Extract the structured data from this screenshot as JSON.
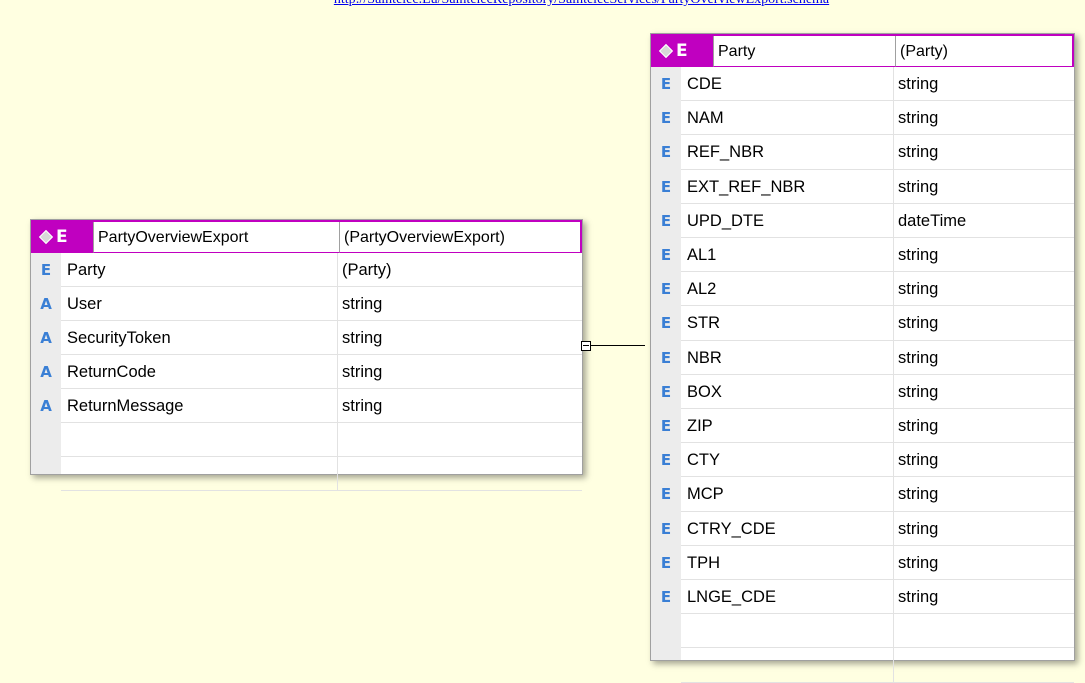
{
  "header_link": {
    "text": "http://Saintelec.Lu/SaintelecRepository/SaintelecServices/PartyOverviewExport.schema"
  },
  "colors": {
    "background": "#ffffe1",
    "header_accent": "#c000c0",
    "element_icon": "#3a7fd5",
    "gutter": "#ececec"
  },
  "icons": {
    "element": "E",
    "attribute": "A",
    "header": "diamond-icon"
  },
  "left_table": {
    "header": {
      "name": "PartyOverviewExport",
      "type": "(PartyOverviewExport)"
    },
    "rows": [
      {
        "kind": "E",
        "name": "Party",
        "type": "(Party)"
      },
      {
        "kind": "A",
        "name": "User",
        "type": "string"
      },
      {
        "kind": "A",
        "name": "SecurityToken",
        "type": "string"
      },
      {
        "kind": "A",
        "name": "ReturnCode",
        "type": "string"
      },
      {
        "kind": "A",
        "name": "ReturnMessage",
        "type": "string"
      }
    ]
  },
  "right_table": {
    "header": {
      "name": "Party",
      "type": "(Party)"
    },
    "rows": [
      {
        "kind": "E",
        "name": "CDE",
        "type": "string"
      },
      {
        "kind": "E",
        "name": "NAM",
        "type": "string"
      },
      {
        "kind": "E",
        "name": "REF_NBR",
        "type": "string"
      },
      {
        "kind": "E",
        "name": "EXT_REF_NBR",
        "type": "string"
      },
      {
        "kind": "E",
        "name": "UPD_DTE",
        "type": "dateTime"
      },
      {
        "kind": "E",
        "name": "AL1",
        "type": "string"
      },
      {
        "kind": "E",
        "name": "AL2",
        "type": "string"
      },
      {
        "kind": "E",
        "name": "STR",
        "type": "string"
      },
      {
        "kind": "E",
        "name": "NBR",
        "type": "string"
      },
      {
        "kind": "E",
        "name": "BOX",
        "type": "string"
      },
      {
        "kind": "E",
        "name": "ZIP",
        "type": "string"
      },
      {
        "kind": "E",
        "name": "CTY",
        "type": "string"
      },
      {
        "kind": "E",
        "name": "MCP",
        "type": "string"
      },
      {
        "kind": "E",
        "name": "CTRY_CDE",
        "type": "string"
      },
      {
        "kind": "E",
        "name": "TPH",
        "type": "string"
      },
      {
        "kind": "E",
        "name": "LNGE_CDE",
        "type": "string"
      }
    ]
  }
}
